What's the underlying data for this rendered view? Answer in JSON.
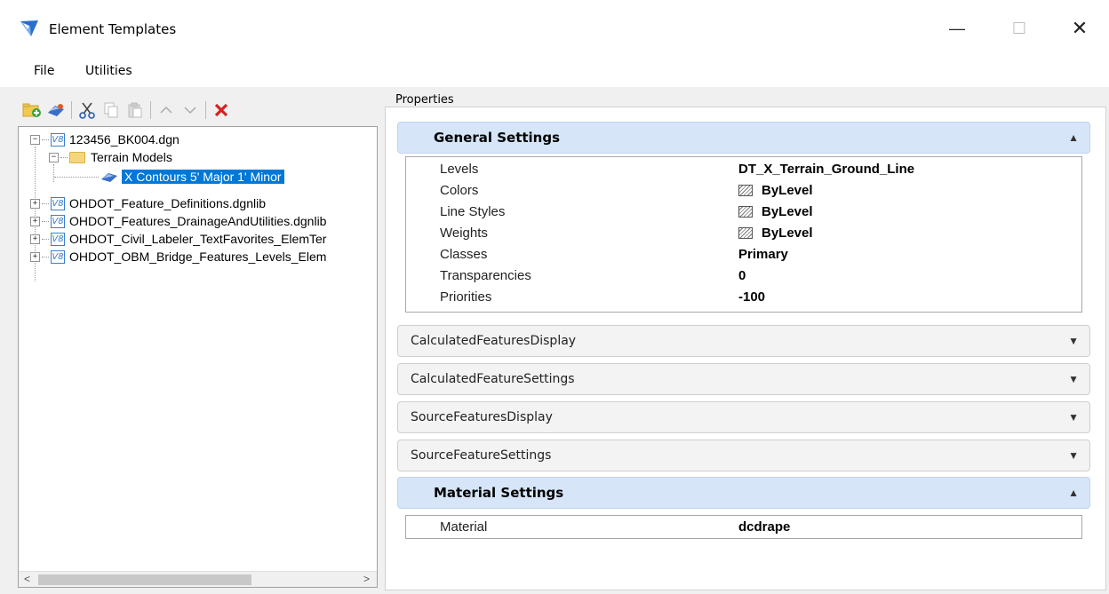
{
  "window": {
    "title": "Element Templates",
    "minimize": "—",
    "maximize": "☐",
    "close": "✕"
  },
  "menu": {
    "file": "File",
    "utilities": "Utilities"
  },
  "toolbar": {
    "buttons": [
      "add-folder-icon",
      "add-template-icon",
      "cut-icon",
      "copy-icon",
      "paste-icon",
      "move-up-icon",
      "move-down-icon",
      "delete-icon"
    ]
  },
  "tree": {
    "root": "123456_BK004.dgn",
    "folder": "Terrain Models",
    "selected": "X Contours 5' Major 1' Minor",
    "libs": [
      "OHDOT_Feature_Definitions.dgnlib",
      "OHDOT_Features_DrainageAndUtilities.dgnlib",
      "OHDOT_Civil_Labeler_TextFavorites_ElemTer",
      "OHDOT_OBM_Bridge_Features_Levels_Elem"
    ],
    "v8_label": "V8"
  },
  "properties": {
    "label": "Properties",
    "general": {
      "title": "General Settings",
      "rows": [
        {
          "name": "Levels",
          "value": "DT_X_Terrain_Ground_Line",
          "swatch": false
        },
        {
          "name": "Colors",
          "value": "ByLevel",
          "swatch": true
        },
        {
          "name": "Line Styles",
          "value": "ByLevel",
          "swatch": true
        },
        {
          "name": "Weights",
          "value": "ByLevel",
          "swatch": true
        },
        {
          "name": "Classes",
          "value": "Primary",
          "swatch": false
        },
        {
          "name": "Transparencies",
          "value": "0",
          "swatch": false
        },
        {
          "name": "Priorities",
          "value": "-100",
          "swatch": false
        }
      ]
    },
    "collapsed_sections": [
      "CalculatedFeaturesDisplay",
      "CalculatedFeatureSettings",
      "SourceFeaturesDisplay",
      "SourceFeatureSettings"
    ],
    "material": {
      "title": "Material Settings",
      "name": "Material",
      "value": "dcdrape"
    }
  }
}
